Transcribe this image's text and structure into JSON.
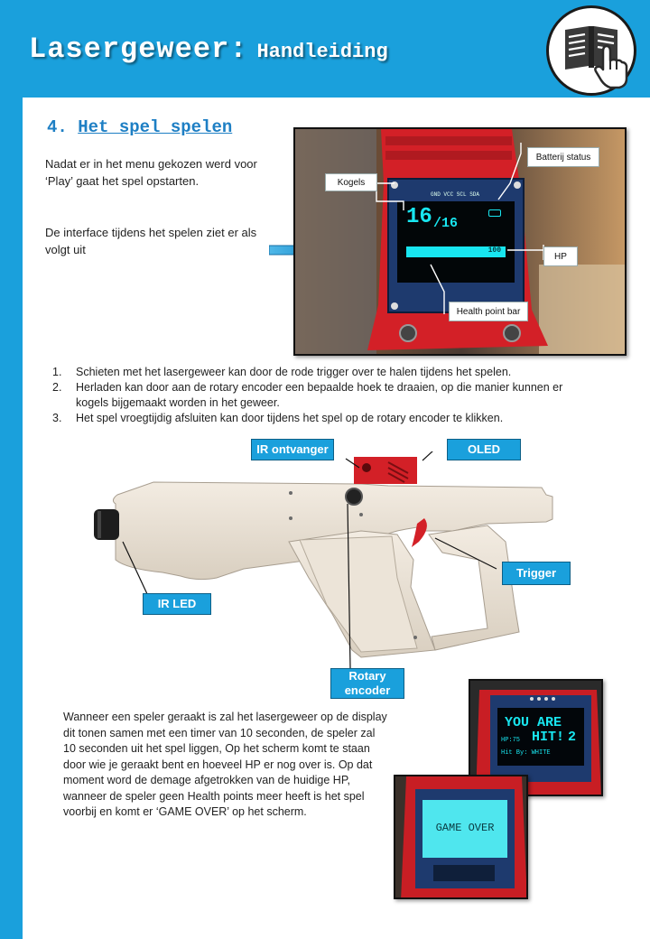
{
  "header": {
    "title": "Lasergeweer:",
    "subtitle": "Handleiding",
    "icon": "manual-book-touch-icon"
  },
  "section": {
    "number": "4.",
    "title": "Het spel spelen"
  },
  "intro": {
    "paragraph1": "Nadat er in het menu gekozen werd voor ‘Play’ gaat het spel opstarten.",
    "paragraph2": "De interface tijdens het spelen ziet er als volgt uit"
  },
  "oled_photo": {
    "display_ammo": "16",
    "display_ammo_max": "/16",
    "display_hp": "100",
    "pin_labels": "GND VCC SCL SDA",
    "labels": {
      "kogels": "Kogels",
      "batterij": "Batterij status",
      "hp": "HP",
      "health_bar": "Health point bar"
    }
  },
  "steps": [
    {
      "num": "1.",
      "text": "Schieten met het lasergeweer kan door de rode trigger over te halen tijdens het spelen."
    },
    {
      "num": "2.",
      "text": "Herladen kan door aan de rotary encoder een bepaalde hoek te draaien, op die manier kunnen er kogels bijgemaakt worden in het geweer."
    },
    {
      "num": "3.",
      "text": "Het spel vroegtijdig afsluiten kan door tijdens het spel op de rotary encoder te klikken."
    }
  ],
  "gun_labels": {
    "ir_receiver": "IR ontvanger",
    "oled": "OLED",
    "trigger": "Trigger",
    "ir_led": "IR LED",
    "rotary_line1": "Rotary",
    "rotary_line2": "encoder"
  },
  "hit": {
    "paragraph": "Wanneer een speler geraakt is zal het lasergeweer op de display dit tonen samen met een timer van 10 seconden, de speler zal 10 seconden uit het spel liggen, Op het scherm komt te staan door wie je geraakt bent en hoeveel HP er nog over is. Op dat moment word de demage afgetrokken van de huidige HP, wanneer de speler geen Health points meer heeft is het spel voorbij en komt er ‘GAME OVER’ op het scherm.",
    "screen_line1": "YOU ARE",
    "screen_line2": "HIT!",
    "screen_timer": "2",
    "screen_hp": "HP:75",
    "screen_by": "Hit By: WHITE",
    "game_over": "GAME OVER"
  },
  "colors": {
    "accent": "#1aa0dc",
    "heading": "#1e7fc4",
    "oled_cyan": "#18e6f0",
    "case_red": "#d32027"
  }
}
